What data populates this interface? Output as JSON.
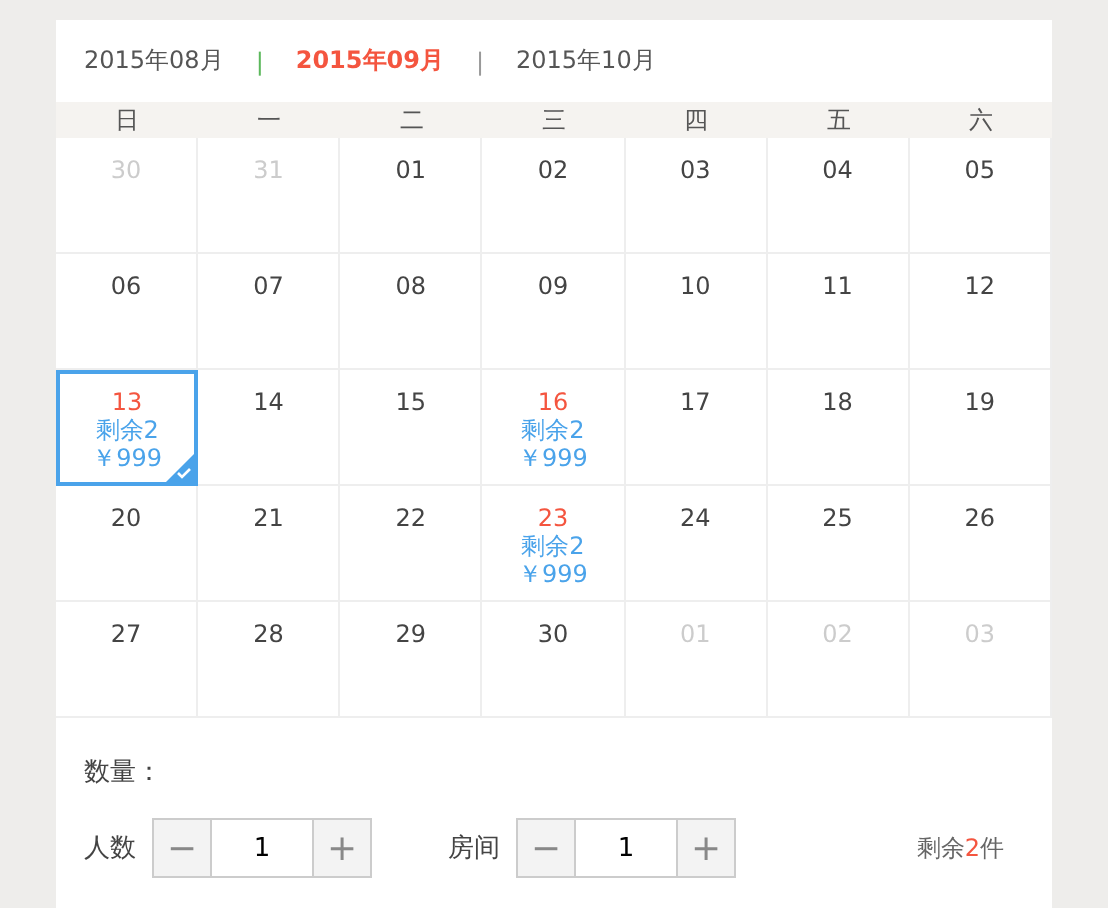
{
  "months": [
    {
      "label": "2015年08月",
      "selected": false
    },
    {
      "label": "2015年09月",
      "selected": true
    },
    {
      "label": "2015年10月",
      "selected": false
    }
  ],
  "separators": [
    "|",
    "|"
  ],
  "weekdays": [
    "日",
    "一",
    "二",
    "三",
    "四",
    "五",
    "六"
  ],
  "weeks": [
    [
      {
        "day": "30",
        "muted": true
      },
      {
        "day": "31",
        "muted": true
      },
      {
        "day": "01",
        "muted": false
      },
      {
        "day": "02",
        "muted": false
      },
      {
        "day": "03",
        "muted": false
      },
      {
        "day": "04",
        "muted": false
      },
      {
        "day": "05",
        "muted": false
      }
    ],
    [
      {
        "day": "06",
        "muted": false
      },
      {
        "day": "07",
        "muted": false
      },
      {
        "day": "08",
        "muted": false
      },
      {
        "day": "09",
        "muted": false
      },
      {
        "day": "10",
        "muted": false
      },
      {
        "day": "11",
        "muted": false
      },
      {
        "day": "12",
        "muted": false
      }
    ],
    [
      {
        "day": "13",
        "muted": false,
        "available": true,
        "selected": true,
        "stock": "剩余2",
        "price": "￥999"
      },
      {
        "day": "14",
        "muted": false
      },
      {
        "day": "15",
        "muted": false
      },
      {
        "day": "16",
        "muted": false,
        "available": true,
        "selected": false,
        "stock": "剩余2",
        "price": "￥999"
      },
      {
        "day": "17",
        "muted": false
      },
      {
        "day": "18",
        "muted": false
      },
      {
        "day": "19",
        "muted": false
      }
    ],
    [
      {
        "day": "20",
        "muted": false
      },
      {
        "day": "21",
        "muted": false
      },
      {
        "day": "22",
        "muted": false
      },
      {
        "day": "23",
        "muted": false,
        "available": true,
        "selected": false,
        "stock": "剩余2",
        "price": "￥999"
      },
      {
        "day": "24",
        "muted": false
      },
      {
        "day": "25",
        "muted": false
      },
      {
        "day": "26",
        "muted": false
      }
    ],
    [
      {
        "day": "27",
        "muted": false
      },
      {
        "day": "28",
        "muted": false
      },
      {
        "day": "29",
        "muted": false
      },
      {
        "day": "30",
        "muted": false
      },
      {
        "day": "01",
        "muted": true
      },
      {
        "day": "02",
        "muted": true
      },
      {
        "day": "03",
        "muted": true
      }
    ]
  ],
  "quantity": {
    "label": "数量：",
    "steppers": [
      {
        "label": "人数",
        "minus": "−",
        "value": "1",
        "plus": "+"
      },
      {
        "label": "房间",
        "minus": "−",
        "value": "1",
        "plus": "+"
      }
    ],
    "remaining": {
      "prefix": "剩余",
      "count": "2",
      "suffix": "件"
    }
  }
}
